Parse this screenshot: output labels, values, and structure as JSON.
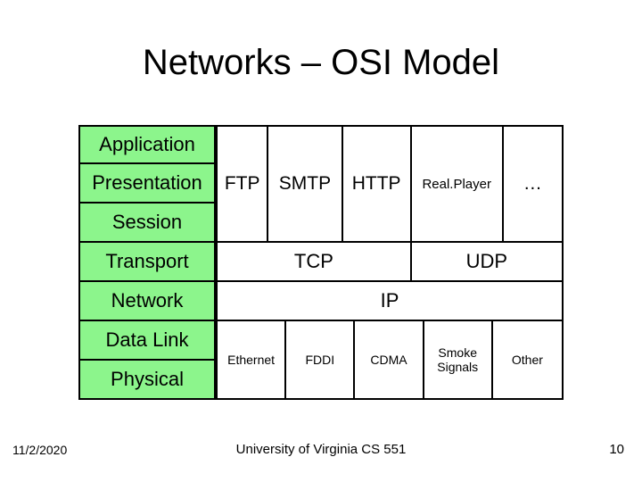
{
  "title": "Networks – OSI Model",
  "osi_layers": {
    "application": "Application",
    "presentation": "Presentation",
    "session": "Session",
    "transport": "Transport",
    "network": "Network",
    "datalink": "Data Link",
    "physical": "Physical"
  },
  "app_protocols": {
    "ftp": "FTP",
    "smtp": "SMTP",
    "http": "HTTP",
    "realplayer": "Real.Player",
    "ellipsis": "…"
  },
  "transport_protocols": {
    "tcp": "TCP",
    "udp": "UDP"
  },
  "network_protocol": "IP",
  "link_protocols": {
    "ethernet": "Ethernet",
    "fddi": "FDDI",
    "cdma": "CDMA",
    "smoke": "Smoke\nSignals",
    "other": "Other"
  },
  "footer": {
    "date": "11/2/2020",
    "center": "University of Virginia CS 551",
    "page": "10"
  }
}
